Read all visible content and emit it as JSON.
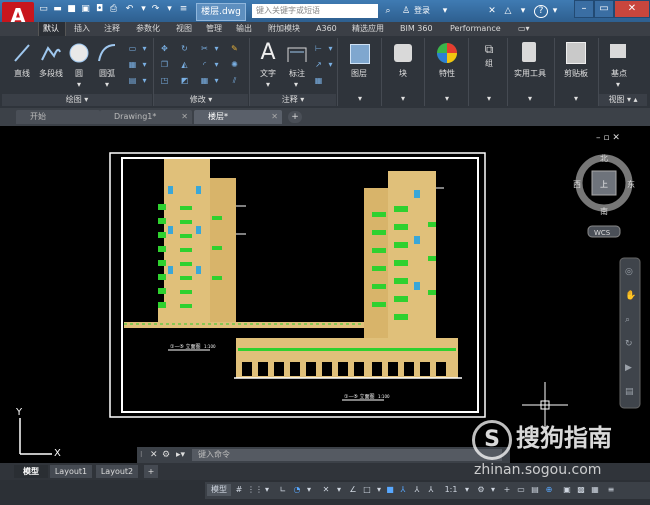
{
  "titlebar": {
    "logo": "A",
    "doc_tab": "楼层.dwg",
    "search_placeholder": "键入关键字或短语",
    "login": "登录",
    "help": "?"
  },
  "ribbon_tabs": [
    "默认",
    "插入",
    "注释",
    "参数化",
    "视图",
    "管理",
    "输出",
    "附加模块",
    "A360",
    "精选应用",
    "BIM 360",
    "Performance"
  ],
  "ribbon": {
    "draw_tools": [
      "直线",
      "多段线",
      "圆",
      "圆弧"
    ],
    "annot_tools": [
      "文字",
      "标注"
    ],
    "layer": "图层",
    "block": "块",
    "properties": "特性",
    "group": "组",
    "utilities": "实用工具",
    "clipboard": "剪贴板",
    "base": "基点",
    "panels": [
      "绘图",
      "修改",
      "注释",
      "视图"
    ]
  },
  "file_tabs": [
    {
      "label": "开始"
    },
    {
      "label": "Drawing1*"
    },
    {
      "label": "楼层*"
    }
  ],
  "viewcube": {
    "north": "北",
    "south": "南",
    "east": "东",
    "west": "西",
    "face": "上",
    "wcs": "WCS"
  },
  "ucs": {
    "x": "X",
    "y": "Y"
  },
  "drawing": {
    "label_left": "①—⑤ 立面图",
    "scale_left": "1:100",
    "label_right": "①—⑤ 立面图",
    "scale_right": "1:100"
  },
  "command": {
    "placeholder": "键入命令"
  },
  "layout_tabs": [
    "模型",
    "Layout1",
    "Layout2"
  ],
  "status": {
    "model": "模型",
    "scale": "1:1"
  },
  "watermark": {
    "logo": "S",
    "text": "搜狗指南",
    "url": "zhinan.sogou.com"
  },
  "colors": {
    "building": "#e0c07a",
    "balcony": "#2fd12f",
    "frame": "#ffffff",
    "accent_red": "#c8161d"
  }
}
